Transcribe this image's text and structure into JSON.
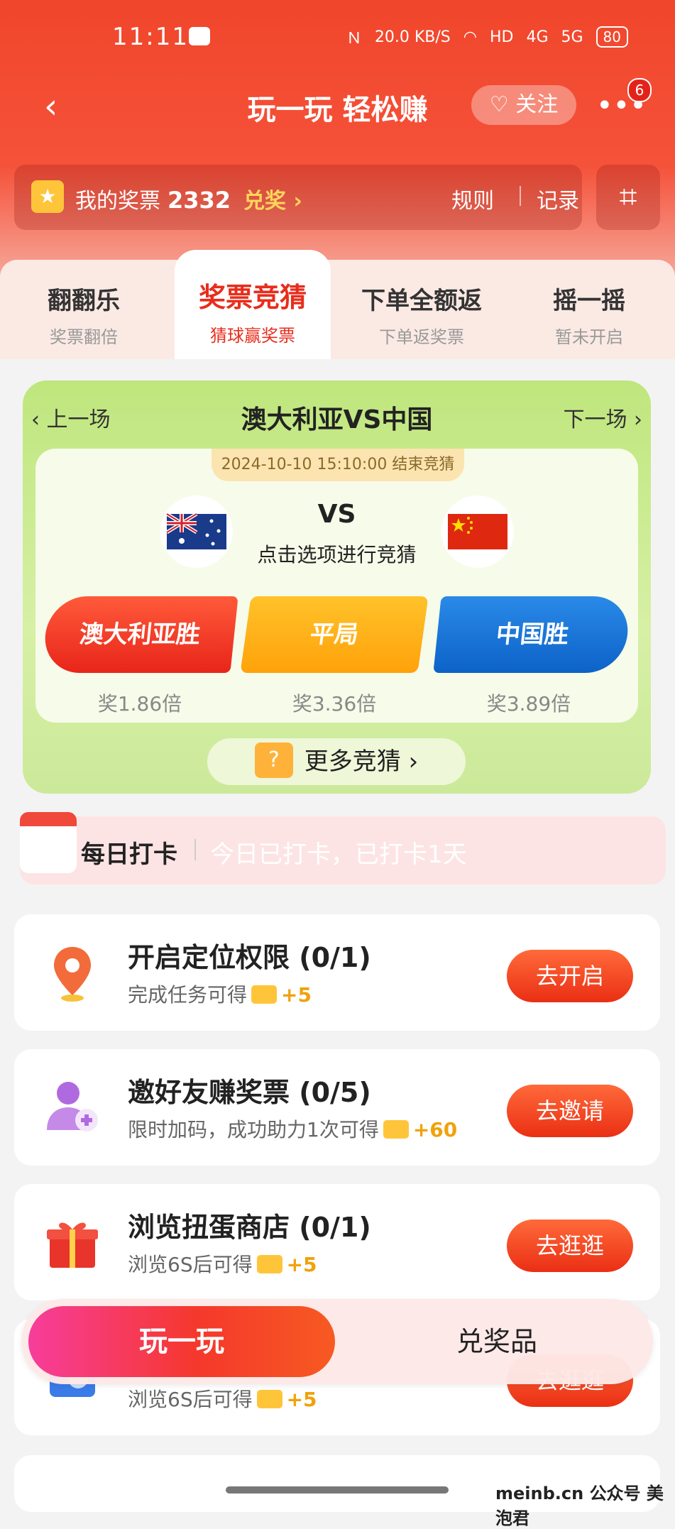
{
  "status_bar": {
    "time": "11:11",
    "speed": "20.0 KB/S",
    "network_1": "4G",
    "network_2": "5G",
    "battery": "80"
  },
  "nav": {
    "title": "玩一玩 轻松赚",
    "follow_label": "关注",
    "more_badge": "6"
  },
  "ticket_bar": {
    "label": "我的奖票",
    "count": "2332",
    "redeem_label": "兑奖",
    "rules_label": "规则",
    "records_label": "记录"
  },
  "tabs": [
    {
      "title": "翻翻乐",
      "subtitle": "奖票翻倍"
    },
    {
      "title": "奖票竞猜",
      "subtitle": "猜球赢奖票"
    },
    {
      "title": "下单全额返",
      "subtitle": "下单返奖票"
    },
    {
      "title": "摇一摇",
      "subtitle": "暂未开启"
    }
  ],
  "match": {
    "prev_label": "上一场",
    "title": "澳大利亚VS中国",
    "next_label": "下一场",
    "deadline": "2024-10-10 15:10:00 结束竞猜",
    "vs": "VS",
    "hint": "点击选项进行竞猜",
    "options": [
      {
        "label": "澳大利亚胜",
        "odds": "奖1.86倍",
        "color": "#e8251a"
      },
      {
        "label": "平局",
        "odds": "奖3.36倍",
        "color": "#ffa20a"
      },
      {
        "label": "中国胜",
        "odds": "奖3.89倍",
        "color": "#0d62c8"
      }
    ],
    "more_label": "更多竞猜"
  },
  "checkin": {
    "label": "每日打卡",
    "status": "今日已打卡，已打卡1天"
  },
  "tasks": [
    {
      "name": "开启定位权限 (0/1)",
      "desc": "完成任务可得",
      "points": "+5",
      "button": "去开启"
    },
    {
      "name": "邀好友赚奖票 (0/5)",
      "desc": "限时加码，成功助力1次可得",
      "points": "+60",
      "button": "去邀请"
    },
    {
      "name": "浏览扭蛋商店 (0/1)",
      "desc": "浏览6S后可得",
      "points": "+5",
      "button": "去逛逛"
    },
    {
      "name": "",
      "desc": "浏览6S后可得",
      "points": "+5",
      "button": "去逛逛"
    }
  ],
  "bottom_nav": {
    "play_label": "玩一玩",
    "prize_label": "兑奖品"
  },
  "watermark": "meinb.cn 公众号 美泡君"
}
